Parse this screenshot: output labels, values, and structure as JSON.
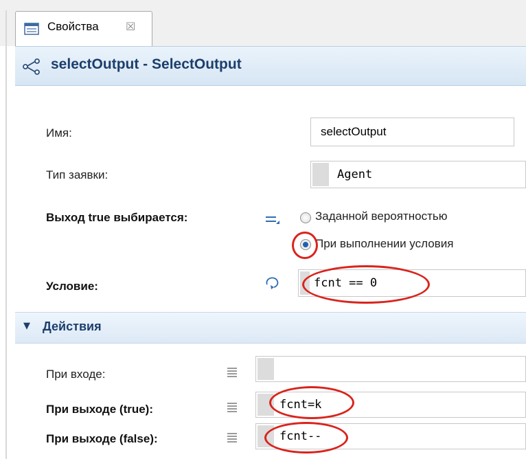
{
  "tab": {
    "label": "Свойства",
    "close_glyph": "☒"
  },
  "header": {
    "title": "selectOutput - SelectOutput"
  },
  "fields": {
    "name": {
      "label": "Имя:",
      "value": "selectOutput"
    },
    "agent_type": {
      "label": "Тип заявки:",
      "value": "Agent"
    },
    "output_true": {
      "label": "Выход true выбирается:",
      "options": [
        "Заданной вероятностью",
        "При выполнении условия"
      ],
      "selected_index": 1
    },
    "condition": {
      "label": "Условие:",
      "value": "fcnt == 0"
    }
  },
  "actions": {
    "title": "Действия",
    "on_enter": {
      "label": "При входе:",
      "value": ""
    },
    "on_exit_true": {
      "label": "При выходе (true):",
      "value": "fcnt=k"
    },
    "on_exit_false": {
      "label": "При выходе (false):",
      "value": "fcnt--"
    }
  },
  "icons": {
    "tab": "properties-icon",
    "header": "select-output-icon",
    "static_value": "equals-icon",
    "dynamic_value": "refresh-icon",
    "code": "code-lines-icon"
  },
  "colors": {
    "header_title": "#1c3e6c",
    "annotation": "#d9241c",
    "radio_selected": "#1f5fb0"
  }
}
